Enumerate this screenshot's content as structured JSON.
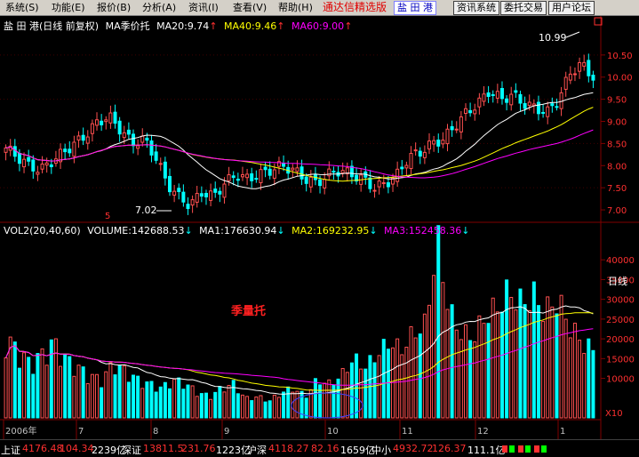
{
  "menu": {
    "items": [
      "系统(S)",
      "功能(E)",
      "报价(B)",
      "分析(A)",
      "资讯(I)",
      "查看(V)",
      "帮助(H)"
    ],
    "brand": "通达信精选版",
    "stock": "盐 田 港",
    "buttons": [
      "资讯系统",
      "委托交易",
      "用户论坛"
    ]
  },
  "price_header": {
    "title": "盐 田 港(日线 前复权)",
    "indicator": "MA季价托",
    "ma20_label": "MA20:9.74",
    "ma40_label": "MA40:9.46",
    "ma60_label": "MA60:9.00",
    "up_arrow": "↑"
  },
  "volume_header": {
    "title": "VOL2(20,40,60)",
    "volume_label": "VOLUME:142688.53",
    "ma1_label": "MA1:176630.94",
    "ma2_label": "MA2:169232.95",
    "ma3_label": "MA3:152458.36",
    "down_arrow": "↓"
  },
  "annotations": {
    "high_label": "10.99",
    "low_label": "7.02",
    "low_marker": "5",
    "volume_caption": "季量托",
    "period_label": "日线",
    "corner_label": "X10"
  },
  "price_axis": [
    "10.99",
    "10.50",
    "10.00",
    "9.50",
    "9.00",
    "8.50",
    "8.00",
    "7.50",
    "7.00"
  ],
  "volume_axis": [
    "40000",
    "35000",
    "30000",
    "25000",
    "20000",
    "15000",
    "10000"
  ],
  "time_axis": [
    "2006年",
    "7",
    "8",
    "9",
    "10",
    "11",
    "12",
    "1"
  ],
  "statusbar": {
    "sh_name": "上证",
    "sh_price": "4176.48",
    "sh_change": "104.34",
    "sh_amount": "2239亿",
    "sz_name": "深证",
    "sz_price": "13811.5",
    "sz_change": "231.76",
    "sz_amount": "1223亿",
    "hs_name": "沪深",
    "hs_price": "4118.27",
    "hs_change": "82.16",
    "hs_amount": "1659亿",
    "zx_name": "中小",
    "zx_price": "4932.72",
    "zx_change": "126.37",
    "zx_amount": "111.1亿"
  },
  "colors": {
    "up": "#ff5050",
    "down": "#00ffff",
    "ma20": "#ffffff",
    "ma40": "#ffff00",
    "ma60": "#ff00ff",
    "grid": "#800000",
    "axis_text": "#ff3030"
  },
  "chart_data": {
    "type": "candlestick",
    "title": "盐 田 港(日线 前复权)",
    "ylim": [
      6.8,
      11.1
    ],
    "x_ticks": [
      "2006年",
      "7",
      "8",
      "9",
      "10",
      "11",
      "12",
      "1"
    ],
    "close_path": [
      8.4,
      8.2,
      8.0,
      7.9,
      8.1,
      8.3,
      8.5,
      8.7,
      9.0,
      9.1,
      8.8,
      8.5,
      8.6,
      8.2,
      7.6,
      7.3,
      7.1,
      7.4,
      7.3,
      7.6,
      7.8,
      7.7,
      7.8,
      7.9,
      8.0,
      7.9,
      7.7,
      7.6,
      7.8,
      7.9,
      7.8,
      7.7,
      7.5,
      7.6,
      7.8,
      8.2,
      8.3,
      8.5,
      8.6,
      8.9,
      9.2,
      9.4,
      9.7,
      9.5,
      9.6,
      9.4,
      9.3,
      9.2,
      9.5,
      10.1,
      10.3,
      10.0
    ],
    "ma_lines": [
      {
        "name": "MA20",
        "value": 9.74
      },
      {
        "name": "MA40",
        "value": 9.46
      },
      {
        "name": "MA60",
        "value": 9.0
      }
    ],
    "volume_ylim": [
      0,
      45000
    ],
    "volume_path": [
      19000,
      16000,
      13000,
      15000,
      18000,
      14000,
      12000,
      10000,
      9000,
      13000,
      11000,
      9000,
      8000,
      7000,
      9000,
      8000,
      6000,
      5000,
      7000,
      8000,
      4500,
      5000,
      4000,
      6000,
      7000,
      5000,
      9000,
      8000,
      10000,
      14000,
      12000,
      15000,
      18000,
      16000,
      20000,
      22000,
      42000,
      25000,
      20000,
      19000,
      24000,
      26000,
      30000,
      27000,
      29000,
      25000,
      28000,
      22000,
      18000,
      16000
    ]
  }
}
